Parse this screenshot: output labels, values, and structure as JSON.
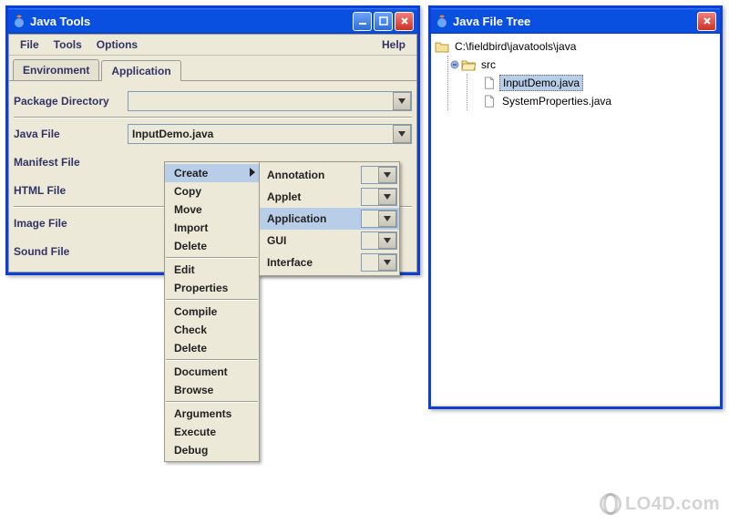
{
  "tools_window": {
    "title": "Java Tools",
    "menu": {
      "file": "File",
      "tools": "Tools",
      "options": "Options",
      "help": "Help"
    },
    "tabs": {
      "environment": "Environment",
      "application": "Application"
    },
    "fields": {
      "package_dir": {
        "label": "Package Directory",
        "value": ""
      },
      "java_file": {
        "label": "Java File",
        "value": "InputDemo.java"
      },
      "manifest": {
        "label": "Manifest File",
        "value": ""
      },
      "html": {
        "label": "HTML File",
        "value": ""
      },
      "image": {
        "label": "Image File",
        "value": ""
      },
      "sound": {
        "label": "Sound File",
        "value": ""
      }
    },
    "context_menu": {
      "groups": [
        [
          "Create",
          "Copy",
          "Move",
          "Import",
          "Delete"
        ],
        [
          "Edit",
          "Properties"
        ],
        [
          "Compile",
          "Check",
          "Delete"
        ],
        [
          "Document",
          "Browse"
        ],
        [
          "Arguments",
          "Execute",
          "Debug"
        ]
      ],
      "highlighted": "Create"
    },
    "submenu": {
      "items": [
        "Annotation",
        "Applet",
        "Application",
        "GUI",
        "Interface"
      ],
      "highlighted": "Application"
    }
  },
  "tree_window": {
    "title": "Java File Tree",
    "root": "C:\\fieldbird\\javatools\\java",
    "folder": "src",
    "files": [
      "InputDemo.java",
      "SystemProperties.java"
    ],
    "selected": "InputDemo.java"
  },
  "watermark": "LO4D.com"
}
